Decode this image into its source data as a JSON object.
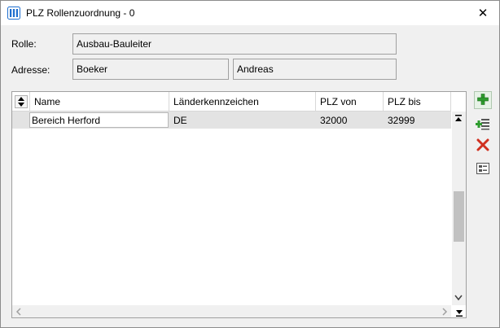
{
  "window": {
    "title": "PLZ Rollenzuordnung - 0",
    "app_icon": "app-columns-icon",
    "close_glyph": "✕"
  },
  "form": {
    "rolle_label": "Rolle:",
    "rolle_value": "Ausbau-Bauleiter",
    "adresse_label": "Adresse:",
    "adresse_last": "Boeker",
    "adresse_first": "Andreas"
  },
  "grid": {
    "columns": [
      "Name",
      "Länderkennzeichen",
      "PLZ von",
      "PLZ bis"
    ],
    "rows": [
      {
        "name": "Bereich Herford",
        "land": "DE",
        "plz_von": "32000",
        "plz_bis": "32999"
      }
    ]
  },
  "side_toolbar": {
    "add": "plus-icon",
    "insert": "insert-row-icon",
    "delete": "delete-x-icon",
    "details": "details-icon"
  },
  "colors": {
    "accent_blue": "#1e6fcf",
    "add_green": "#2e9c2e",
    "delete_red": "#d03020"
  }
}
